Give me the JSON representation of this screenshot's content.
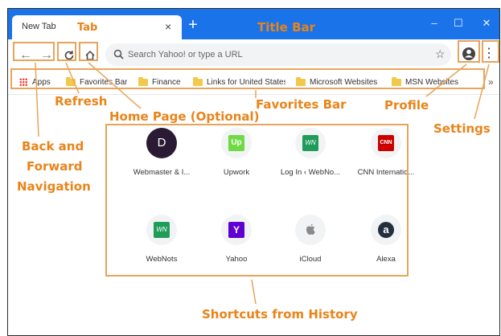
{
  "tab": {
    "title": "New Tab",
    "close": "×",
    "new": "+"
  },
  "window": {
    "minimize": "–",
    "maximize": "☐",
    "close": "✕"
  },
  "toolbar": {
    "back": "←",
    "forward": "→",
    "search_placeholder": "Search Yahoo! or type a URL",
    "star": "☆",
    "settings": "⋮"
  },
  "favorites_bar": {
    "items": [
      {
        "label": "Apps",
        "icon": "apps-grid-icon"
      },
      {
        "label": "Favorites Bar",
        "icon": "folder-icon"
      },
      {
        "label": "Finance",
        "icon": "folder-icon"
      },
      {
        "label": "Links for United States",
        "icon": "folder-icon"
      },
      {
        "label": "Microsoft Websites",
        "icon": "folder-icon"
      },
      {
        "label": "MSN Websites",
        "icon": "folder-icon"
      }
    ],
    "more": "»"
  },
  "shortcuts": [
    {
      "label": "Webmaster & I...",
      "icon_text": "D",
      "icon": "webmaster-logo-icon",
      "color": "#2b1a33"
    },
    {
      "label": "Upwork",
      "icon_text": "Up",
      "icon": "upwork-logo-icon",
      "color": "#6fda44"
    },
    {
      "label": "Log In ‹ WebNo...",
      "icon_text": "WN",
      "icon": "webnots-logo-icon",
      "color": "#1f9b5a"
    },
    {
      "label": "CNN Internatio...",
      "icon_text": "CNN",
      "icon": "cnn-logo-icon",
      "color": "#cc0000"
    },
    {
      "label": "WebNots",
      "icon_text": "WN",
      "icon": "webnots-logo-icon",
      "color": "#1f9b5a"
    },
    {
      "label": "Yahoo",
      "icon_text": "Y",
      "icon": "yahoo-logo-icon",
      "color": "#5f01d1"
    },
    {
      "label": "iCloud",
      "icon_text": "",
      "icon": "apple-logo-icon",
      "color": "#aaaaaa"
    },
    {
      "label": "Alexa",
      "icon_text": "a",
      "icon": "alexa-logo-icon",
      "color": "#232f3e"
    }
  ],
  "annotations": {
    "tab": "Tab",
    "title_bar": "Title Bar",
    "refresh": "Refresh",
    "home_page": "Home Page (Optional)",
    "favorites_bar": "Favorites Bar",
    "profile": "Profile",
    "settings": "Settings",
    "back_forward_1": "Back and",
    "back_forward_2": "Forward",
    "back_forward_3": "Navigation",
    "shortcuts": "Shortcuts from History"
  },
  "colors": {
    "titlebar": "#1a73e8",
    "annotation": "#e8841a"
  }
}
